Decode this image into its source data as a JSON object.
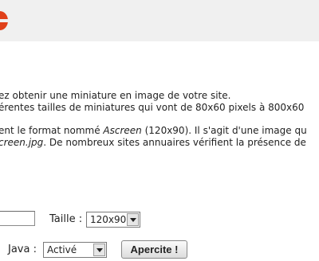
{
  "intro": {
    "line1": "ez obtenir une miniature en image de votre site.",
    "line2": "érentes tailles de miniatures qui vont de 80x60 pixels à 800x60"
  },
  "format": {
    "line1_a": "ent le format nommé ",
    "line1_em": "Ascreen",
    "line1_b": " (120x90). Il s'agit d'une image qu",
    "line2_em": "creen.jpg",
    "line2_b": ". De nombreux sites annuaires vérifient la présence de"
  },
  "form": {
    "url_value": "",
    "taille_label": "Taille :",
    "taille_value": "120x90",
    "java_label": "Java :",
    "java_value": "Activé",
    "submit_label": "Apercite !"
  }
}
